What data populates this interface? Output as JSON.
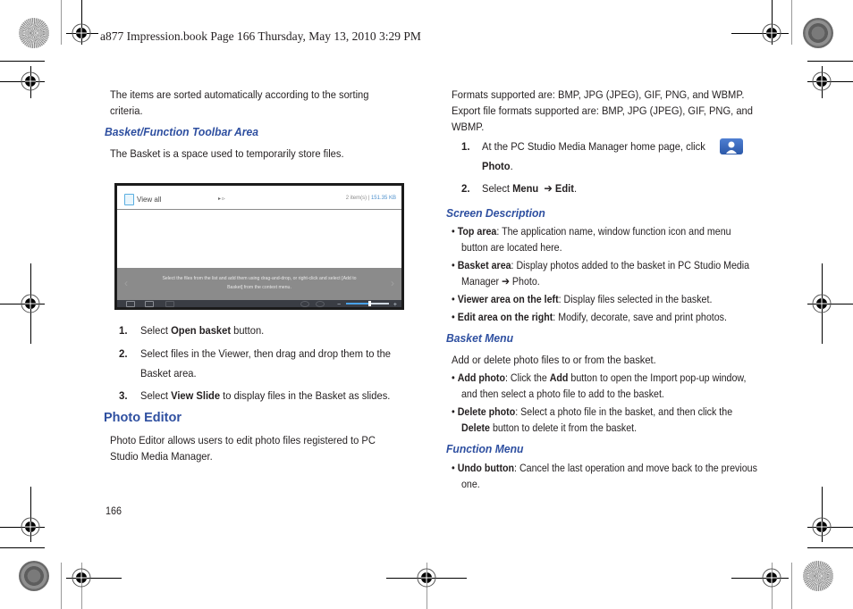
{
  "book_header": "a877 Impression.book  Page 166  Thursday, May 13, 2010  3:29 PM",
  "page_number": "166",
  "left_column": {
    "intro_line1": "The items are sorted automatically according to the sorting",
    "intro_line2": "criteria.",
    "basket_heading": "Basket/Function Toolbar Area",
    "basket_desc": "The Basket is a space used to temporarily store files.",
    "screenshot": {
      "view_label": "View all",
      "arrow_text": "▸ ▹",
      "item_count": "2 item(s) |",
      "size": "151.35 KB",
      "message_line1": "Select the files from the list and add them using drag-and-drop, or right-click and select [Add to",
      "message_line2": "Basket] from the context menu.",
      "nav_prev": "‹",
      "nav_next": "›",
      "zoom_minus": "−",
      "zoom_plus": "+",
      "zoom_level": 0.55
    },
    "steps": [
      {
        "num": "1.",
        "pre": "Select ",
        "bold": "Open basket",
        "post": " button."
      },
      {
        "num": "2.",
        "line1": "Select files in the Viewer, then drag and drop them to the",
        "line2": "Basket area."
      },
      {
        "num": "3.",
        "pre": "Select ",
        "bold": "View Slide",
        "post": " to display files in the Basket as slides."
      }
    ],
    "photo_editor_heading": "Photo Editor",
    "photo_editor_line1": "Photo Editor allows users to edit photo files registered to PC",
    "photo_editor_line2": "Studio Media Manager."
  },
  "right_column": {
    "formats_line1": "Formats supported are: BMP, JPG (JPEG), GIF, PNG, and WBMP.",
    "formats_line2": "Export file formats supported are: BMP, JPG (JPEG), GIF, PNG, and",
    "formats_line3": "WBMP.",
    "steps": [
      {
        "num": "1.",
        "line1": "At the PC Studio Media Manager home page, click",
        "line2_bold": "Photo",
        "line2_post": "."
      },
      {
        "num": "2.",
        "pre": "Select ",
        "bold1": "Menu",
        "arrow": "➔",
        "bold2": "Edit",
        "post": "."
      }
    ],
    "screen_desc_heading": "Screen Description",
    "screen_desc_items": [
      {
        "bold": "Top area",
        "line1": ": The application name, window function icon and menu",
        "line2": "button are located here."
      },
      {
        "bold": "Basket area",
        "line1": ": Display photos added to the basket in PC Studio Media",
        "line2": "Manager  ➔ Photo."
      },
      {
        "bold": "Viewer area on the left",
        "line1": ": Display files selected in the basket."
      },
      {
        "bold": "Edit area on the right",
        "line1": ": Modify, decorate, save and print photos."
      }
    ],
    "basket_menu_heading": "Basket Menu",
    "basket_menu_desc": "Add or delete photo files to or from the basket.",
    "basket_menu_items": [
      {
        "bold": "Add photo",
        "mid1": ": Click the ",
        "bold2": "Add",
        "mid2": " button to open the Import pop-up window,",
        "line2": "and then select a photo file to add to the basket."
      },
      {
        "bold": "Delete photo",
        "mid1": ": Select a photo file in the basket, and then click the",
        "line2_bold": "Delete",
        "line2": " button to delete it from the basket."
      }
    ],
    "function_menu_heading": "Function Menu",
    "function_menu_items": [
      {
        "bold": "Undo button",
        "line1": ": Cancel the last operation and move back to the previous",
        "line2": "one."
      }
    ]
  },
  "bullet_char": "•",
  "colors": {
    "heading_blue": "#2e4fa0",
    "text": "#231f20"
  }
}
